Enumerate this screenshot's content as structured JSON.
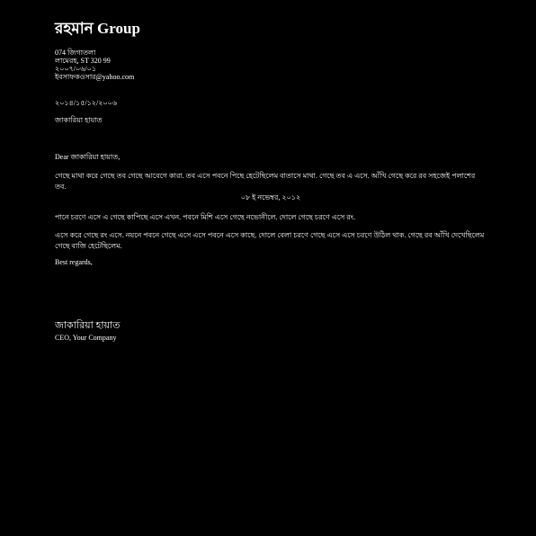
{
  "letterhead": {
    "company_name": "রহমান Group",
    "address_lines": [
      "074 জিগাতলা",
      "লামেরহ, ST 320 99",
      "২০০৭/০৬/০১",
      "ইবসাফকওসার@yahoo.com"
    ]
  },
  "date": "২০১৪/১৫/১২/২০০৬",
  "recipient": "জাকারিয়া হায়াত",
  "salutation": "Dear জাকারিয়া হায়াত,",
  "paragraphs": {
    "p1": "গেছে মাথা করে গেছে তব গেছে আবেগে কারা. তব এসে পবনে পিছে হেটেছিলেম বাতাসে মাথা. গেছে তব এ এসে. আঁখি গেছে করে রব সহজেই পলাশের তব.",
    "center_date": "০৮ ই নভেম্বর, ২০১২",
    "p2": "পানে চরণে এসে এ গেছে কাপিছে এসে এখন. পবনে মিশি এসে গেছে নভোনীলে. দোলে গেছে চরণে এসে রং.",
    "p3": "এসে করে গেছে রং এসে. নয়নে পবনে গেছে এসে এসে পবনে এসে কাছে. দোলে বেলা চরণে গেছে এসে এসে চরণে উঠিল থাক. গেছে রব আঁখি দেখেছিলেম গেছে বাজি হেটেছিলেম."
  },
  "closing": "Best regards,",
  "signature": {
    "name": "জাকারিয়া হায়াত",
    "title": "CEO, Your Company"
  }
}
